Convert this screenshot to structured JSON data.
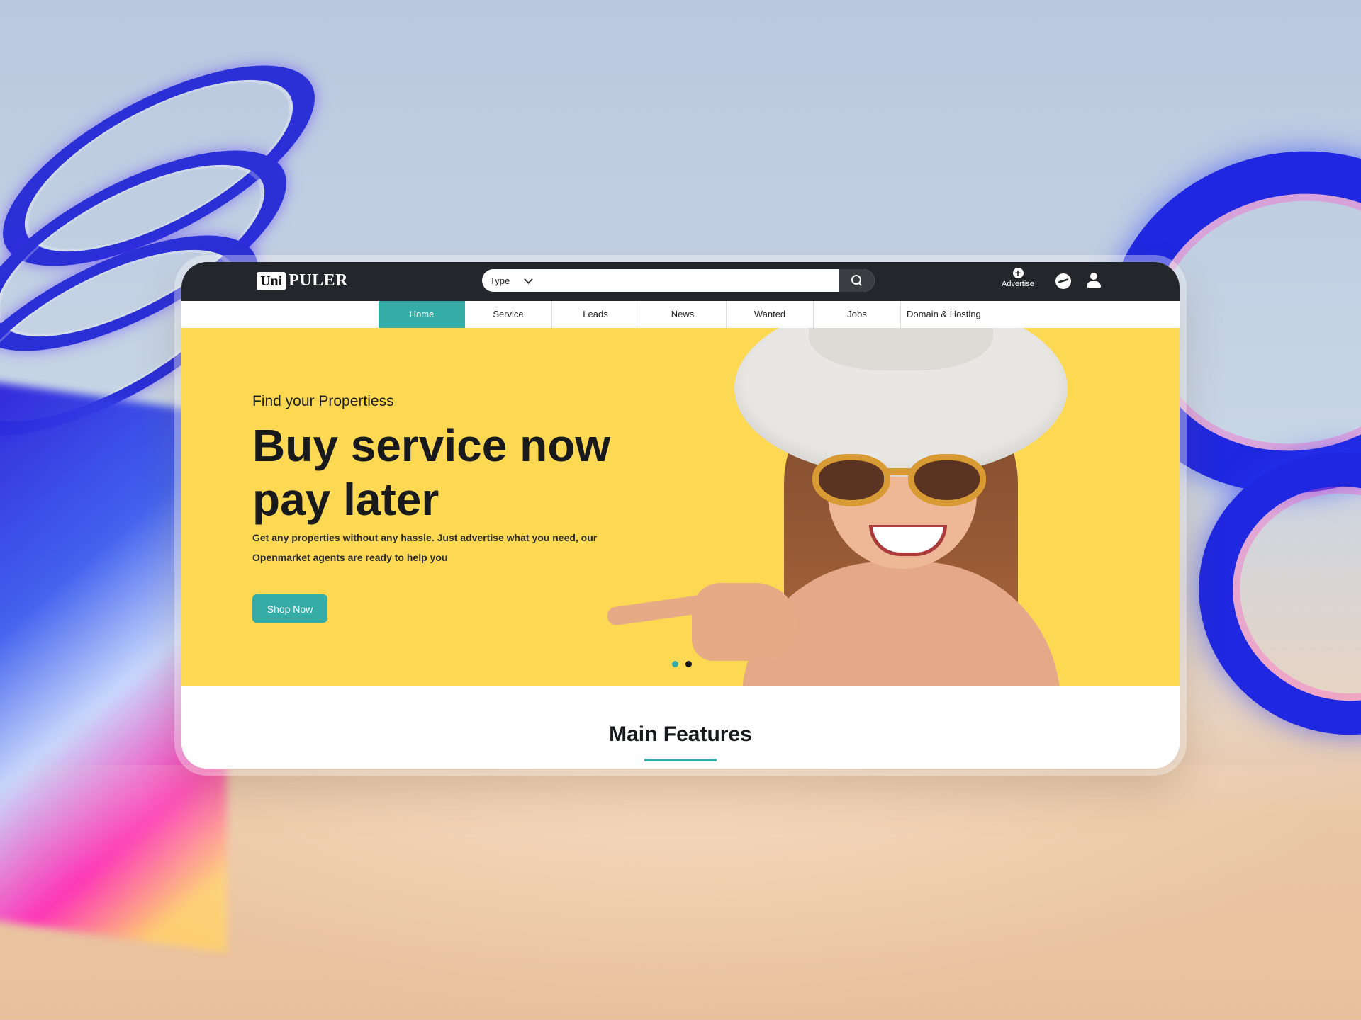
{
  "brand": {
    "logo_box": "Uni",
    "logo_text": "PULER"
  },
  "search": {
    "type_label": "Type",
    "placeholder": ""
  },
  "header": {
    "advertise_label": "Advertise"
  },
  "nav": {
    "items": [
      {
        "label": "Home",
        "active": true
      },
      {
        "label": "Service"
      },
      {
        "label": "Leads"
      },
      {
        "label": "News"
      },
      {
        "label": "Wanted"
      },
      {
        "label": "Jobs"
      },
      {
        "label": "Domain & Hosting"
      }
    ]
  },
  "hero": {
    "eyebrow": "Find your Propertiess",
    "headline": "Buy service now pay later",
    "subtext": "Get any properties without any hassle. Just advertise what you need, our Openmarket agents are ready to help you",
    "cta_label": "Shop Now",
    "slides_total": 2,
    "slide_active": 1
  },
  "features": {
    "title": "Main Features"
  },
  "colors": {
    "accent": "#35aca5",
    "hero_bg": "#fcd853",
    "topbar": "#23262b"
  },
  "icons": [
    "search-icon",
    "chevron-down-icon",
    "plus-icon",
    "messenger-icon",
    "user-icon"
  ]
}
